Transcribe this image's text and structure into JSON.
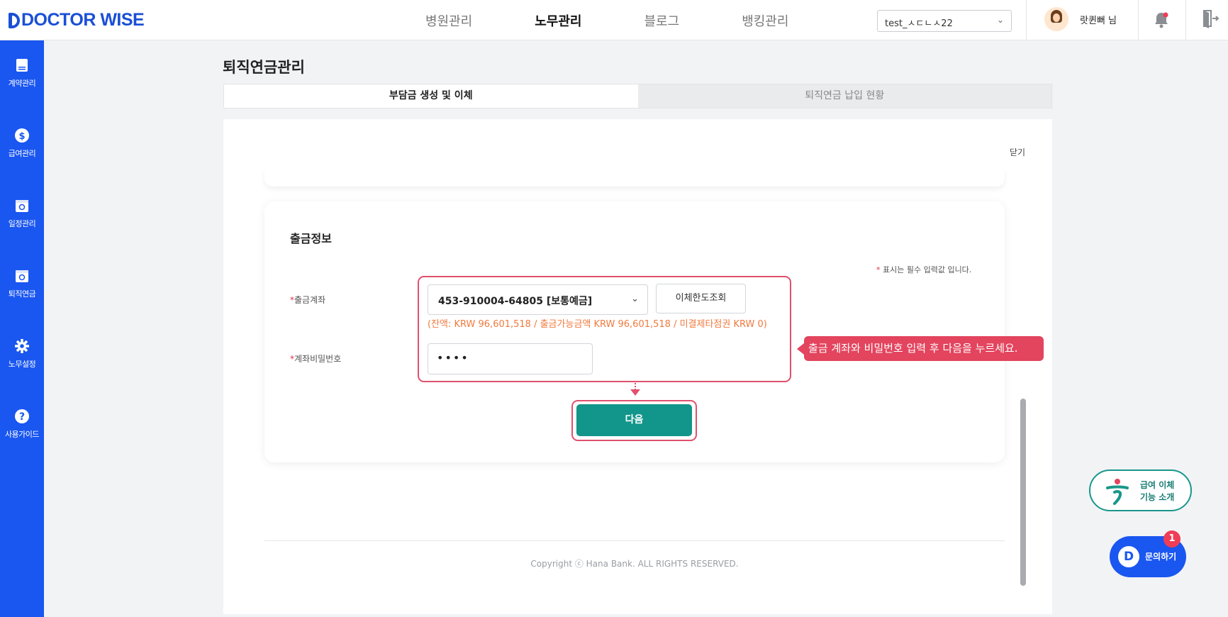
{
  "app": {
    "logo_text": "DOCTOR WISE",
    "brand_color": "#1a56f0",
    "accent_color": "#12958a",
    "highlight_color": "#e0516d"
  },
  "header": {
    "nav": [
      "병원관리",
      "노무관리",
      "블로그",
      "뱅킹관리"
    ],
    "active_nav": "노무관리",
    "account_select": "test_ㅅㄷㄴㅅ22",
    "user_name": "랏퀸뻐 님",
    "icons": [
      "chevron-down-icon",
      "avatar",
      "bell-icon",
      "logout-icon"
    ]
  },
  "sidebar": {
    "items": [
      {
        "label": "계약관리",
        "icon": "contract-icon"
      },
      {
        "label": "급여관리",
        "icon": "dollar-icon"
      },
      {
        "label": "일정관리",
        "icon": "calendar-icon"
      },
      {
        "label": "퇴직연금",
        "icon": "pension-icon"
      },
      {
        "label": "노무설정",
        "icon": "gear-icon"
      },
      {
        "label": "사용가이드",
        "icon": "help-icon"
      }
    ]
  },
  "main": {
    "title": "퇴직연금관리",
    "tabs": [
      {
        "label": "부담금 생성 및 이체",
        "active": true
      },
      {
        "label": "퇴직연금 납입 현황",
        "active": false
      }
    ],
    "close_label": "닫기",
    "section_title": "출금정보",
    "required_note_star": "*",
    "required_note": " 표시는 필수 입력값 입니다.",
    "fields": {
      "account": {
        "star": "*",
        "label": "출금계좌",
        "value": "453-910004-64805 [보통예금]"
      },
      "limit_button": "이체한도조회",
      "balance_note": "(잔액: KRW 96,601,518 / 출금가능금액 KRW 96,601,518 / 미결제타점권 KRW 0)",
      "password": {
        "star": "*",
        "label": "계좌비밀번호",
        "value": "••••"
      }
    },
    "next_button": "다음",
    "tooltip": "출금 계좌와 비밀번호 입력 후 다음을 누르세요.",
    "copyright": "Copyright ⓒ Hana Bank. ALL RIGHTS RESERVED."
  },
  "floating": {
    "promo_line1": "급여 이체",
    "promo_line2": "기능 소개",
    "chat_label": "문의하기",
    "chat_logo": "D",
    "chat_badge": "1"
  }
}
